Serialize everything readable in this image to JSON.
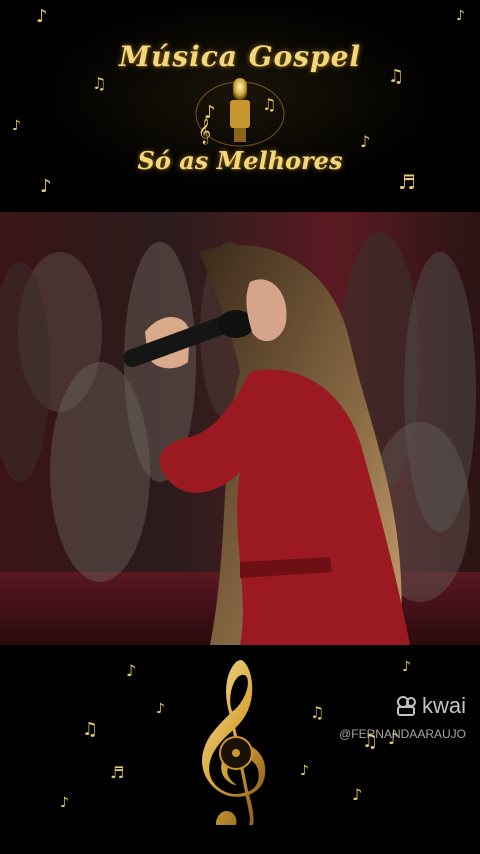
{
  "header": {
    "title_line1": "Música Gospel",
    "title_line2": "Só as Melhores"
  },
  "watermark": {
    "brand": "kwai",
    "handle": "@FERNANDAARAUJO"
  },
  "icons": {
    "logo": "microphone-emblem-icon",
    "footer": "treble-clef-icon",
    "kwai": "kwai-camera-icon"
  },
  "colors": {
    "gold": "#f4d77a",
    "outfit_red": "#9b1a22",
    "background": "#000000"
  }
}
